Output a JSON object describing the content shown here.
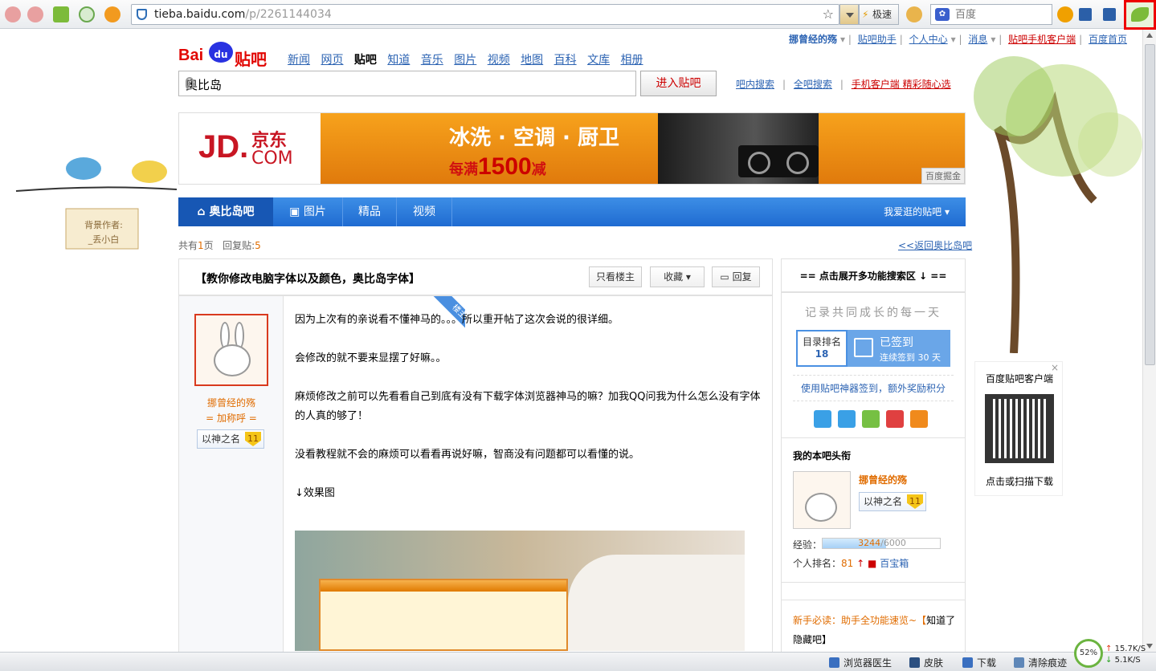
{
  "browser": {
    "url_host": "tieba.baidu.com",
    "url_path": "/p/2261144034",
    "speed_label": "极速",
    "search_placeholder": "百度"
  },
  "userbar": {
    "username": "挪曾经的殇",
    "helper": "贴吧助手",
    "center": "个人中心",
    "messages": "消息",
    "mobile": "贴吧手机客户端",
    "home": "百度首页"
  },
  "logo": {
    "bai": "Bai",
    "du": "du",
    "tieba": "贴吧"
  },
  "topnav": [
    "新闻",
    "网页",
    "贴吧",
    "知道",
    "音乐",
    "图片",
    "视频",
    "地图",
    "百科",
    "文库",
    "相册"
  ],
  "search": {
    "keyword": "奥比岛",
    "enter_button": "进入贴吧",
    "link_in": "吧内搜索",
    "link_all": "全吧搜索",
    "link_mobile": "手机客户端 精彩随心选"
  },
  "banner": {
    "brand_jd": "JD.",
    "brand_cn": "京东",
    "brand_com": "COM",
    "line1": "冰洗 · 空调 · 厨卫",
    "line2_pre": "每满",
    "line2_num": "1500",
    "line2_post": "减",
    "tag": "百度掘金"
  },
  "forumnav": {
    "home": "奥比岛吧",
    "pics": "图片",
    "best": "精品",
    "video": "视频",
    "fav": "我爱逛的贴吧"
  },
  "stats": {
    "pages_pre": "共有",
    "pages": "1",
    "pages_post": "页",
    "replies_pre": "回复贴:",
    "replies": "5",
    "back": "<<返回奥比岛吧"
  },
  "post": {
    "title": "【教你修改电脑字体以及颜色，奥比岛字体】",
    "btn_only_op": "只看楼主",
    "btn_fav": "收藏",
    "btn_reply": "回复",
    "corner": "楼主",
    "author_name": "挪曾经的殇",
    "author_title": "= 加称呼 =",
    "level_name": "以神之名",
    "level_num": "11",
    "paragraphs": [
      "因为上次有的亲说看不懂神马的。。。所以重开帖了这次会说的很详细。",
      "会修改的就不要来显摆了好嘛。。",
      "麻烦修改之前可以先看看自己到底有没有下载字体浏览器神马的嘛？加我QQ问我为什么怎么没有字体的人真的够了！",
      "没看教程就不会的麻烦可以看看再说好嘛，智商没有问题都可以看懂的说。",
      "↓效果图"
    ]
  },
  "sidebar": {
    "header": "==  点击展开多功能搜索区 ↓  ==",
    "motto": "记录共同成长的每一天",
    "rank_label": "目录排名",
    "rank_value": "18",
    "signed": "已签到",
    "signed_days": "连续签到 30 天",
    "promo": "使用贴吧神器签到，额外奖励积分",
    "section_title": "我的本吧头衔",
    "user_name": "挪曾经的殇",
    "level_name": "以神之名",
    "level_num": "11",
    "exp_label": "经验：",
    "exp_current": "3244",
    "exp_total": "/6000",
    "exp_fraction": 0.54,
    "prank_label": "个人排名：",
    "prank_value": "81",
    "treasure": "百宝箱",
    "notice_pre": "新手必读：助手全功能速览~【",
    "notice_link": "知道了隐藏吧",
    "notice_post": "】"
  },
  "qr": {
    "title": "百度贴吧客户端",
    "bottom": "点击或扫描下载"
  },
  "decor": {
    "author_label": "背景作者:",
    "author_name": "_丢小白"
  },
  "statusbar": {
    "doctor": "浏览器医生",
    "skin": "皮肤",
    "download": "下载",
    "clear": "清除痕迹",
    "gauge": "52%",
    "up": "15.7K/S",
    "down": "5.1K/S"
  },
  "colors": {
    "tieba_blue": "#1f6bd1",
    "accent_orange": "#e06c00",
    "baidu_red": "#e10602"
  }
}
